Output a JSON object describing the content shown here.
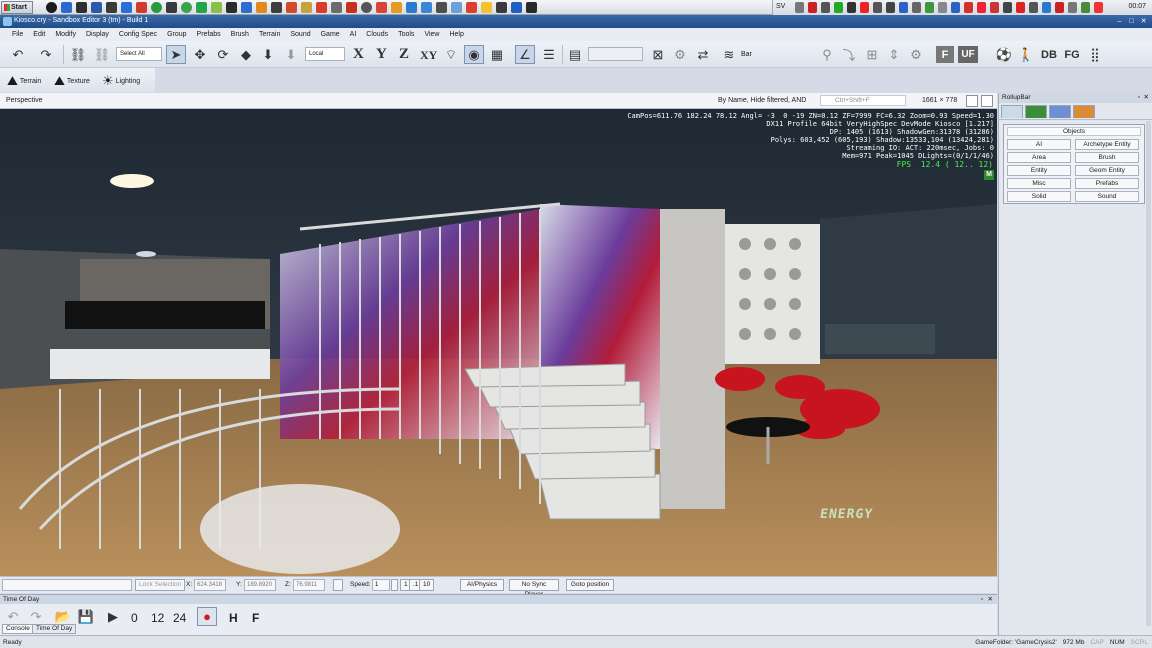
{
  "taskbar": {
    "start_label": "Start",
    "tray_label": "SV",
    "clock": "00:07"
  },
  "window": {
    "title": "Kiosco.cry - Sandbox Editor 3 (tm) - Build 1"
  },
  "menu": [
    "File",
    "Edit",
    "Modify",
    "Display",
    "Config Spec",
    "Group",
    "Prefabs",
    "Brush",
    "Terrain",
    "Sound",
    "Game",
    "AI",
    "Clouds",
    "Tools",
    "View",
    "Help"
  ],
  "toolbar": {
    "select_combo": "Select All",
    "coord_combo": "Local",
    "axis_x": "X",
    "axis_y": "Y",
    "axis_z": "Z",
    "axis_xy": "XY",
    "bar_label": "Bar",
    "btn_f": "F",
    "btn_uf": "UF",
    "btn_db": "DB",
    "btn_fg": "FG",
    "terrain": "Terrain",
    "texture": "Texture",
    "lighting": "Lighting"
  },
  "viewport": {
    "title": "Perspective",
    "filter": "By Name, Hide filtered, AND",
    "search_placeholder": "Ctrl+Shift+F",
    "resolution": "1661 × 778",
    "stats": "CamPos=611.76 182.24 78.12 Angl= -3  0 -19 ZN=0.12 ZF=7999 FC=6.32 Zoom=0.93 Speed=1.30\nDX11 Profile 64bit VeryHighSpec DevMode Kiosco [1.217]\nDP: 1405 (1613) ShadowGen:31378 (31286)\nPolys: 603,452 (605,193) Shadow:13533,104 (13424,281)\nStreaming IO: ACT: 220msec, Jobs: 0\nMem=971 Peak=1045 DLights=(0/1/1/46)",
    "fps": "FPS  12.4 ( 12.. 12)",
    "mode_badge": "M",
    "hud_energy": "ENERGY"
  },
  "bottombar": {
    "lock_selection": "Lock Selection",
    "x_label": "X:",
    "x_value": "624.3418",
    "y_label": "Y:",
    "y_value": "189.8920",
    "z_label": "Z:",
    "z_value": "76.9811",
    "speed_label": "Speed:",
    "speed_value": "1",
    "speed_1": "1",
    "speed_2": ".1",
    "speed_10": "10",
    "ai_physics": "AI/Physics",
    "no_sync": "No Sync Player",
    "goto": "Goto position"
  },
  "time_of_day": {
    "title": "Time Of Day",
    "t0": "0",
    "t12": "12",
    "t24": "24",
    "h": "H",
    "f": "F",
    "console_tab": "Console",
    "tod_tab": "Time Of Day"
  },
  "rollup": {
    "title": "RollupBar",
    "objects_title": "Objects",
    "buttons": [
      "AI",
      "Archetype Entity",
      "Area",
      "Brush",
      "Entity",
      "Geom Entity",
      "Misc",
      "Prefabs",
      "Solid",
      "Sound"
    ]
  },
  "status": {
    "ready": "Ready",
    "game_folder": "GameFolder: 'GameCrysis2'",
    "mem": "972 Mb",
    "cap": "CAP",
    "num": "NUM",
    "scrl": "SCRL"
  }
}
